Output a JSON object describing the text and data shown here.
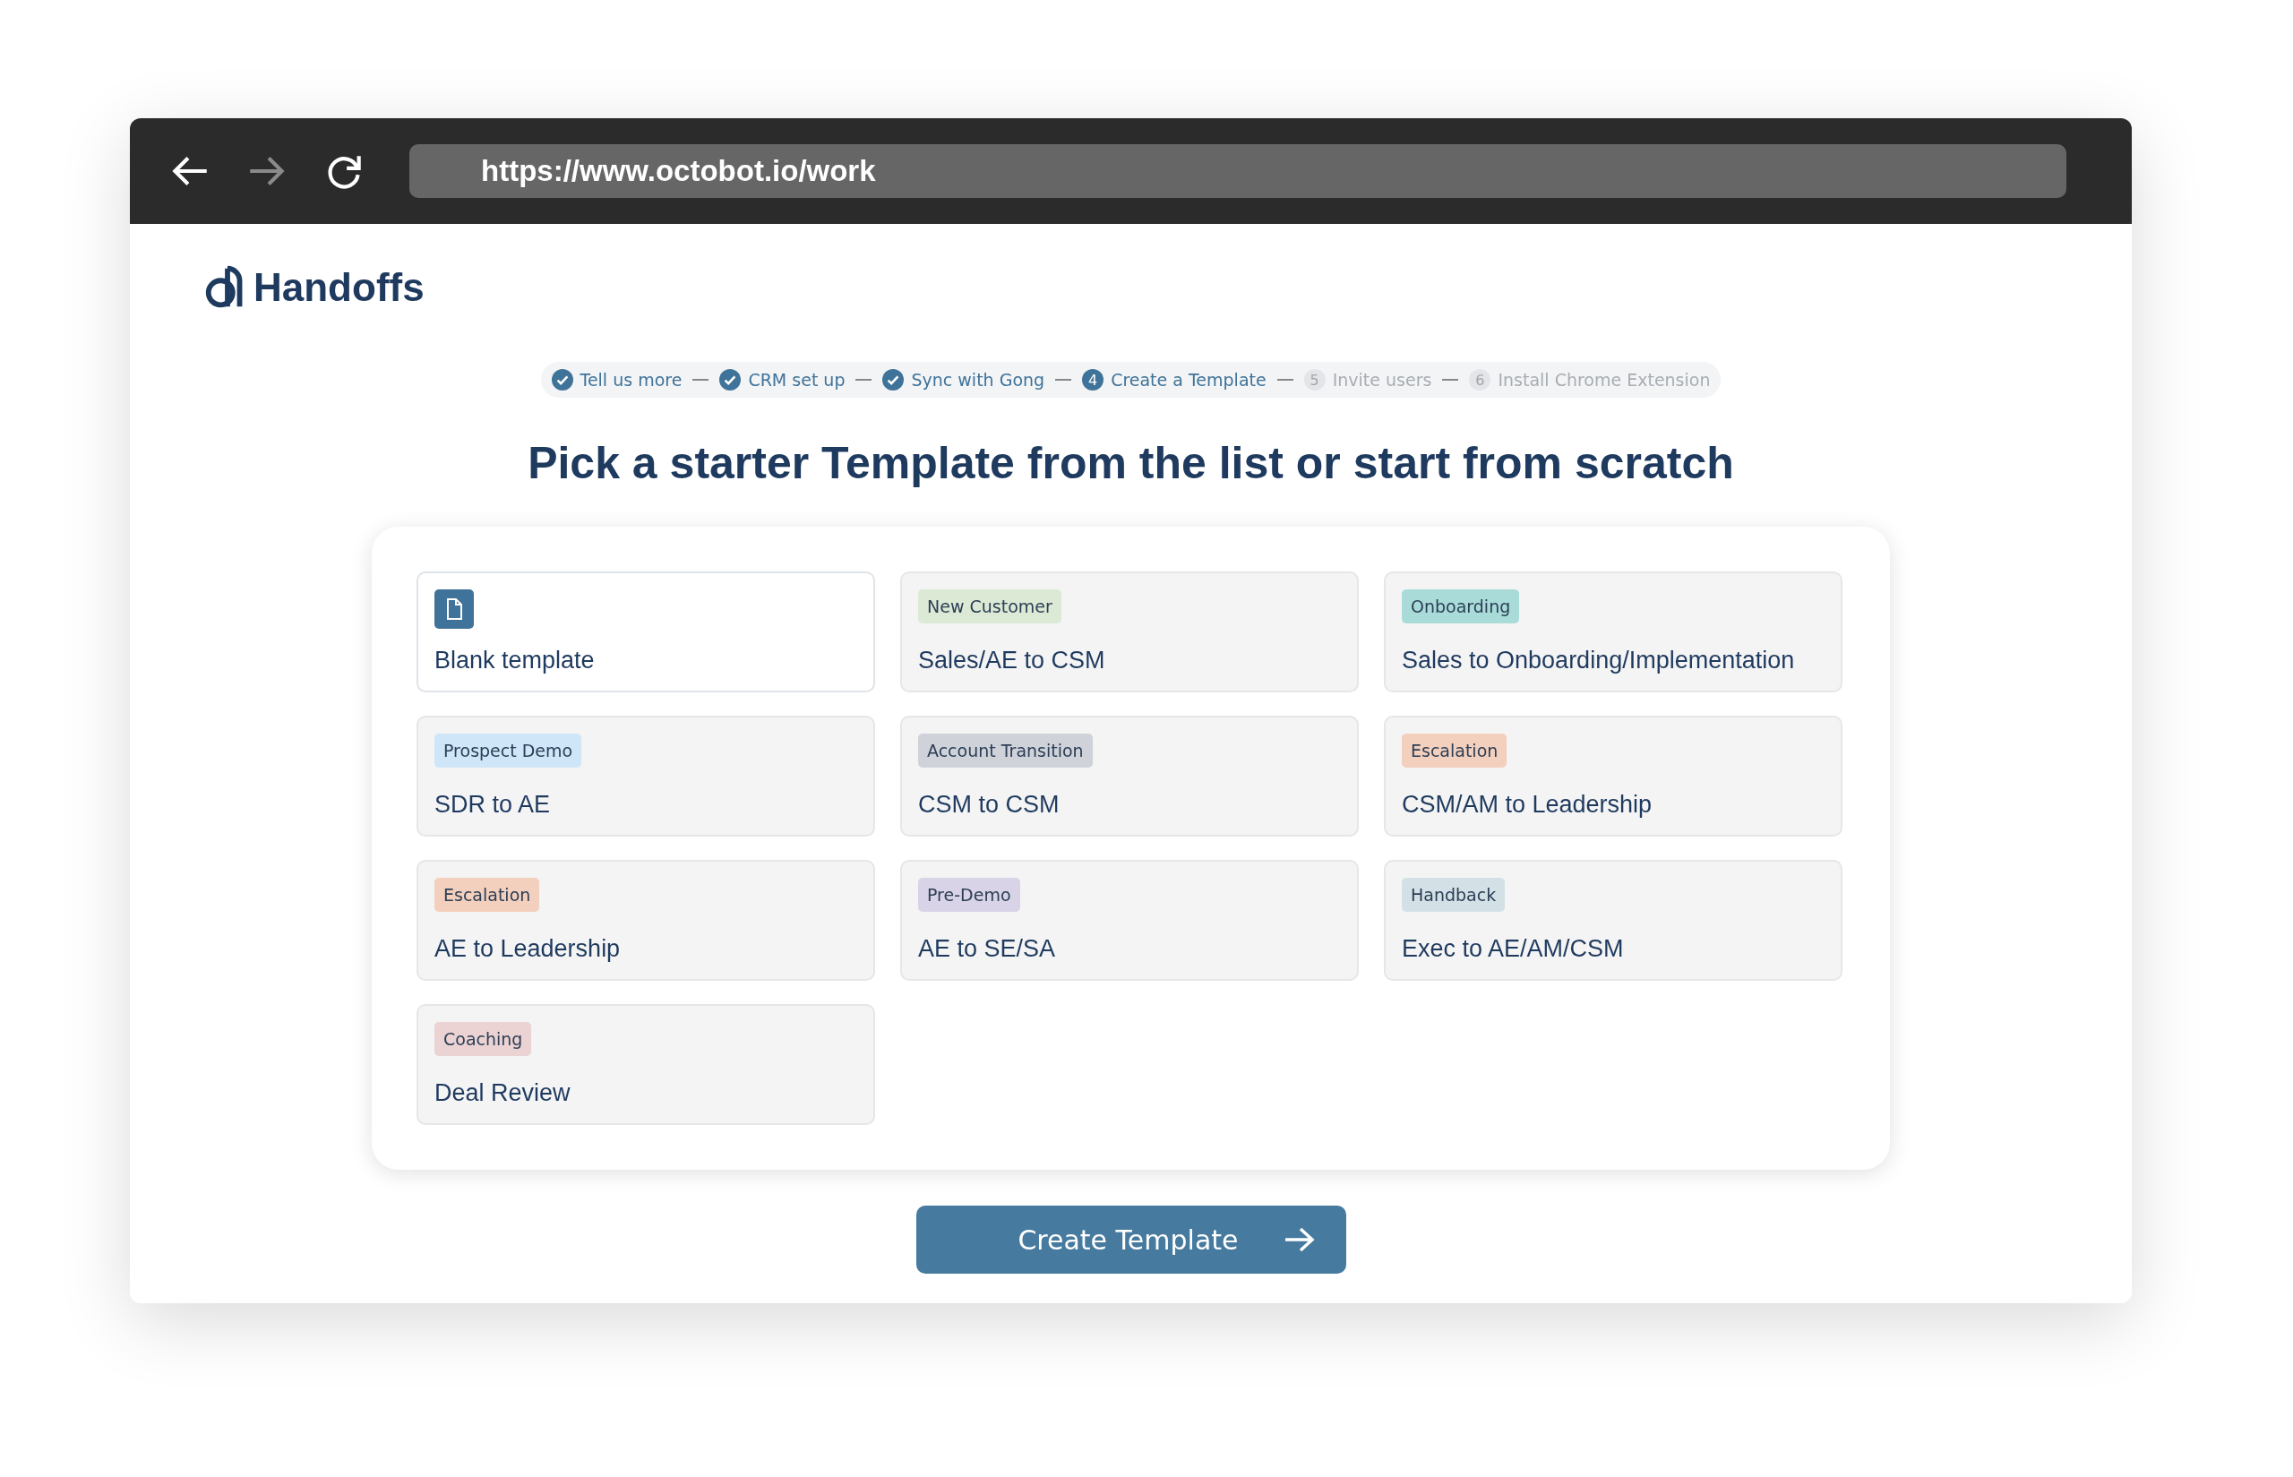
{
  "browser": {
    "url": "https://www.octobot.io/work"
  },
  "logo": {
    "text": "Handoffs"
  },
  "steps": [
    {
      "label": "Tell us more",
      "done": true,
      "current": false
    },
    {
      "label": "CRM set up",
      "done": true,
      "current": false
    },
    {
      "label": "Sync with Gong",
      "done": true,
      "current": false
    },
    {
      "label": "Create a Template",
      "done": false,
      "current": true,
      "number": "4"
    },
    {
      "label": "Invite users",
      "done": false,
      "current": false,
      "number": "5"
    },
    {
      "label": "Install Chrome Extension",
      "done": false,
      "current": false,
      "number": "6"
    }
  ],
  "heading": "Pick a starter Template from the list or start from scratch",
  "templates": [
    {
      "kind": "blank",
      "title": "Blank template",
      "selected": true
    },
    {
      "kind": "tagged",
      "tag": "New Customer",
      "color": "#dbe9d5",
      "title": "Sales/AE to CSM",
      "selected": false
    },
    {
      "kind": "tagged",
      "tag": "Onboarding",
      "color": "#a9dcd9",
      "title": "Sales to Onboarding/Implementation",
      "selected": false
    },
    {
      "kind": "tagged",
      "tag": "Prospect Demo",
      "color": "#cfe6f9",
      "title": "SDR to AE",
      "selected": false
    },
    {
      "kind": "tagged",
      "tag": "Account Transition",
      "color": "#cfd2d9",
      "title": "CSM to CSM",
      "selected": false
    },
    {
      "kind": "tagged",
      "tag": "Escalation",
      "color": "#f3cfbd",
      "title": "CSM/AM to Leadership",
      "selected": false
    },
    {
      "kind": "tagged",
      "tag": "Escalation",
      "color": "#f3cfbd",
      "title": "AE to Leadership",
      "selected": false
    },
    {
      "kind": "tagged",
      "tag": "Pre-Demo",
      "color": "#d8d3e6",
      "title": "AE to SE/SA",
      "selected": false
    },
    {
      "kind": "tagged",
      "tag": "Handback",
      "color": "#d3e1e6",
      "title": "Exec to AE/AM/CSM",
      "selected": false
    },
    {
      "kind": "tagged",
      "tag": "Coaching",
      "color": "#ebd3d3",
      "title": "Deal Review",
      "selected": false
    }
  ],
  "create_button": {
    "label": "Create Template"
  }
}
